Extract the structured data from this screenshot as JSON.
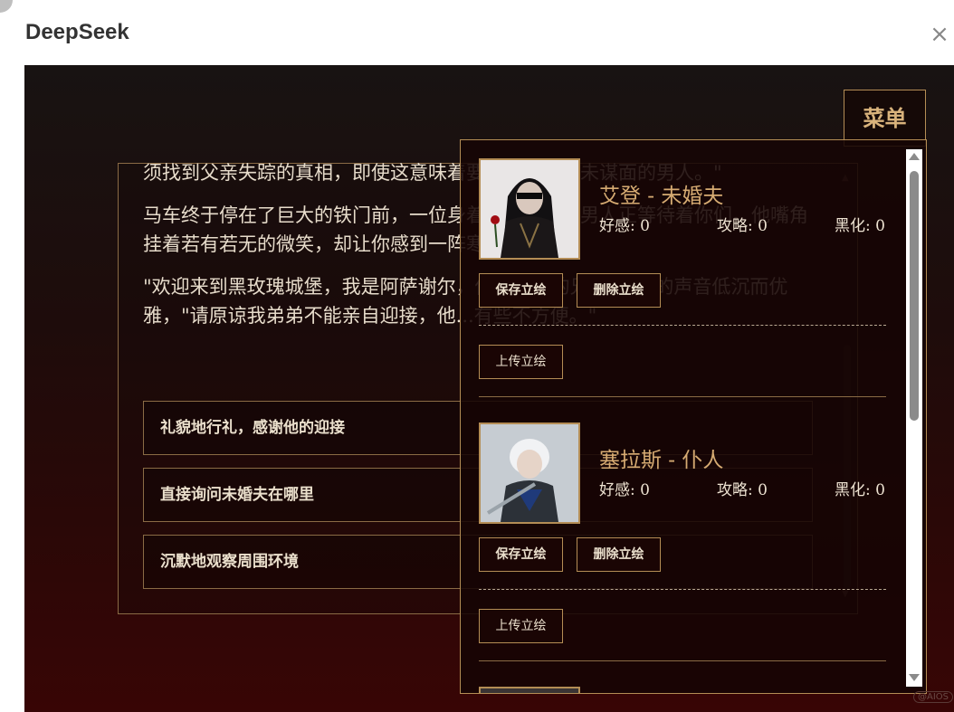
{
  "window": {
    "title": "DeepSeek"
  },
  "story": {
    "paragraphs": [
      "须找到父亲失踪的真相，即使这意味着要嫁给一个素未谋面的男人。\"",
      "马车终于停在了巨大的铁门前，一位身着黑衣的高大男人正等待着你们。他嘴角挂着若有若无的微笑，却让你感到一阵寒意。",
      "\"欢迎来到黑玫瑰城堡，我是阿萨谢尔，你未婚夫的兄长。\"他的声音低沉而优雅，\"请原谅我弟弟不能亲自迎接，他...有些不方便。\""
    ],
    "choices": [
      "礼貌地行礼，感谢他的迎接",
      "直接询问未婚夫在哪里",
      "沉默地观察周围环境"
    ]
  },
  "menu": {
    "label": "菜单"
  },
  "characters": [
    {
      "name": "艾登 - 未婚夫",
      "stats": [
        {
          "label": "好感:",
          "value": "0"
        },
        {
          "label": "攻略:",
          "value": "0"
        },
        {
          "label": "黑化:",
          "value": "0"
        }
      ],
      "save_label": "保存立绘",
      "delete_label": "删除立绘",
      "upload_label": "上传立绘"
    },
    {
      "name": "塞拉斯 - 仆人",
      "stats": [
        {
          "label": "好感:",
          "value": "0"
        },
        {
          "label": "攻略:",
          "value": "0"
        },
        {
          "label": "黑化:",
          "value": "0"
        }
      ],
      "save_label": "保存立绘",
      "delete_label": "删除立绘",
      "upload_label": "上传立绘"
    }
  ],
  "watermark": "@AIOS"
}
